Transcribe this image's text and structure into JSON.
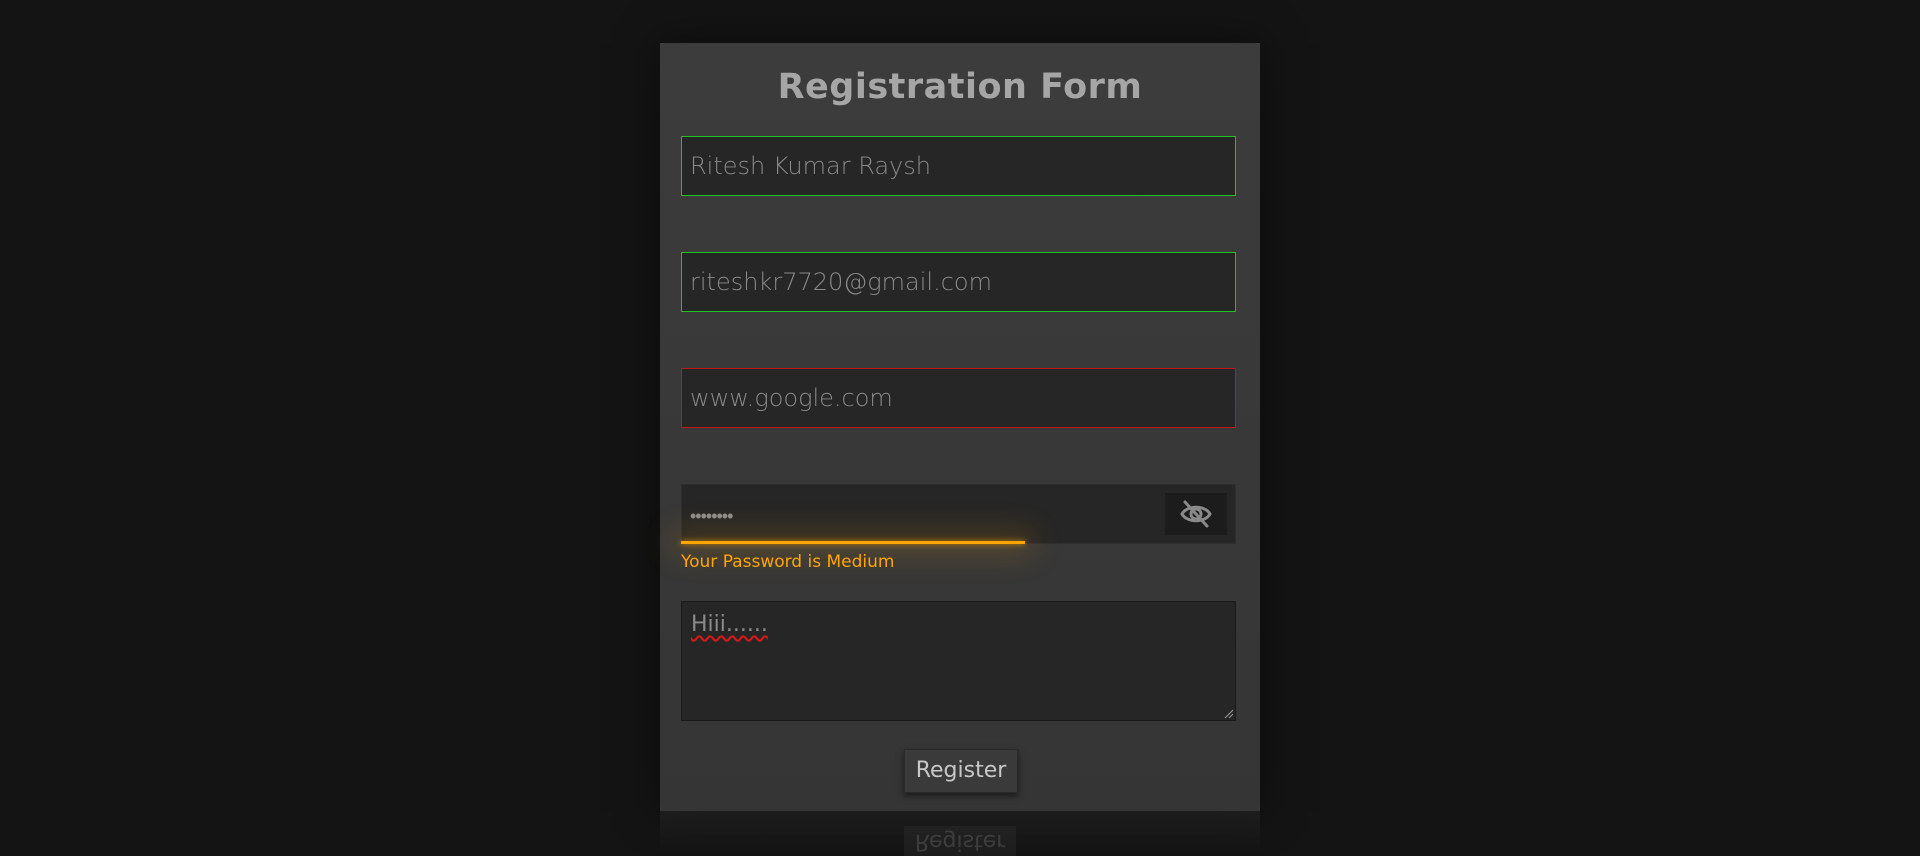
{
  "form": {
    "title": "Registration Form",
    "name_value": "Ritesh Kumar Raysh",
    "email_value": "riteshkr7720@gmail.com",
    "website_value": "www.google.com",
    "password_mask": "••••••••",
    "password_strength_message": "Your Password is Medium",
    "password_strength_level": 0.62,
    "message_value": "Hiii......",
    "register_label": "Register",
    "toggle_icon": "eye-slash-icon"
  },
  "colors": {
    "page_bg": "#141414",
    "panel_bg": "#3c3c3c",
    "valid": "#1fc21f",
    "invalid": "#c21616",
    "strength_medium": "#ffa500",
    "text": "#a6a6a6"
  }
}
